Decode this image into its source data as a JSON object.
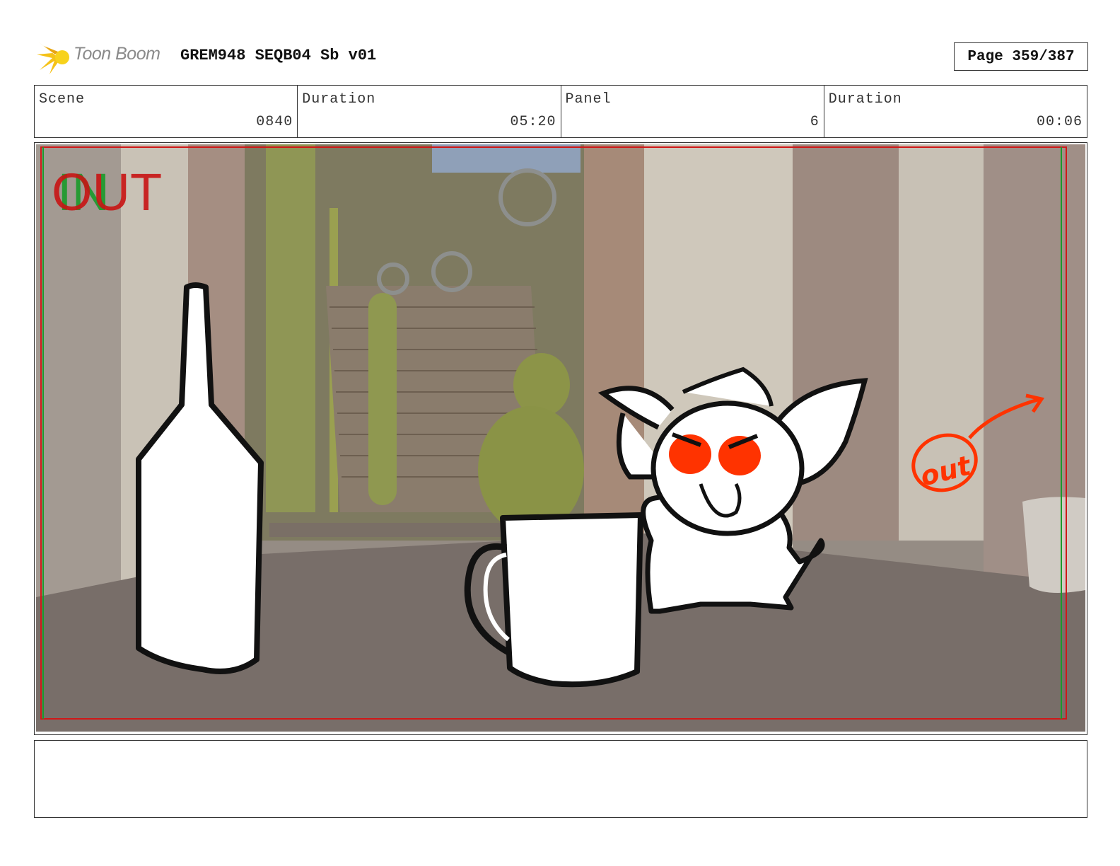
{
  "header": {
    "logo_text": "Toon Boom",
    "title": "GREM948 SEQB04 Sb v01",
    "page": "Page 359/387"
  },
  "info": {
    "scene_label": "Scene",
    "scene_value": "0840",
    "duration_label": "Duration",
    "duration_value": "05:20",
    "panel_label": "Panel",
    "panel_value": "6",
    "panel_duration_label": "Duration",
    "panel_duration_value": "00:06"
  },
  "panel": {
    "in_text": "IN",
    "out_text": "OUT",
    "sketch_note": "out"
  },
  "caption": {
    "text": ""
  },
  "colors": {
    "safe_frame_red": "#d01818",
    "safe_frame_green": "#1a9a2a",
    "annotation_red": "#ff3300"
  }
}
